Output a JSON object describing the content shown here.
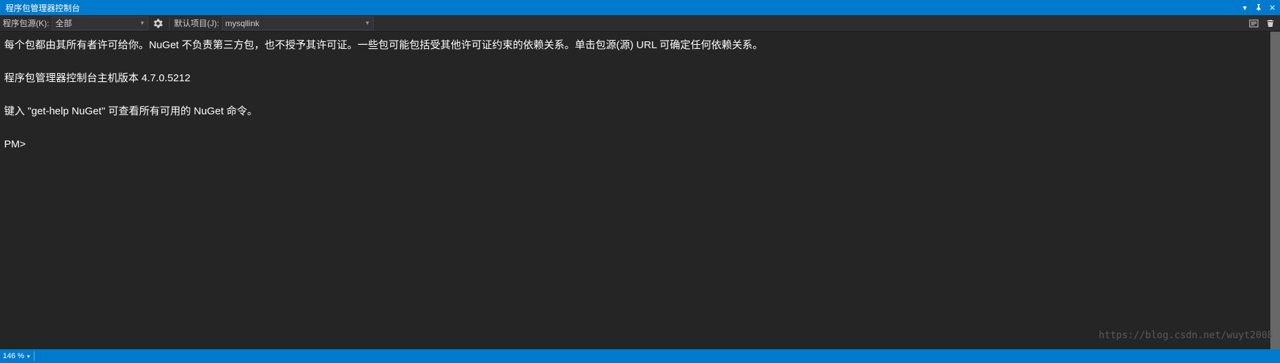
{
  "titleBar": {
    "title": "程序包管理器控制台"
  },
  "toolbar": {
    "sourceLabel": "程序包源(K):",
    "sourceValue": "全部",
    "projectLabel": "默认项目(J):",
    "projectValue": "mysqllink"
  },
  "console": {
    "line1": "每个包都由其所有者许可给你。NuGet 不负责第三方包，也不授予其许可证。一些包可能包括受其他许可证约束的依赖关系。单击包源(源) URL 可确定任何依赖关系。",
    "line2": "程序包管理器控制台主机版本 4.7.0.5212",
    "line3": "键入 \"get-help NuGet\" 可查看所有可用的 NuGet 命令。",
    "prompt": "PM>"
  },
  "statusBar": {
    "zoom": "146 %"
  },
  "watermark": "https://blog.csdn.net/wuyt2008"
}
